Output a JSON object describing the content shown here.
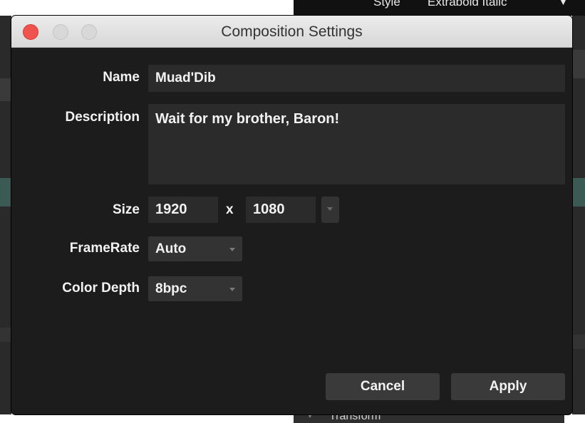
{
  "background": {
    "style_label": "Style",
    "style_value": "Extrabold Italic",
    "panel_item": "Transform"
  },
  "dialog": {
    "title": "Composition Settings",
    "name": {
      "label": "Name",
      "value": "Muad'Dib"
    },
    "description": {
      "label": "Description",
      "value": "Wait for my brother, Baron!"
    },
    "size": {
      "label": "Size",
      "width": "1920",
      "separator": "x",
      "height": "1080"
    },
    "framerate": {
      "label": "FrameRate",
      "value": "Auto"
    },
    "color_depth": {
      "label": "Color Depth",
      "value": "8bpc"
    },
    "buttons": {
      "cancel": "Cancel",
      "apply": "Apply"
    }
  },
  "colors": {
    "dialog_bg": "#1c1c1c",
    "field_bg": "#2b2b2b",
    "button_bg": "#3a3a3a",
    "close_button": "#f0524e"
  }
}
